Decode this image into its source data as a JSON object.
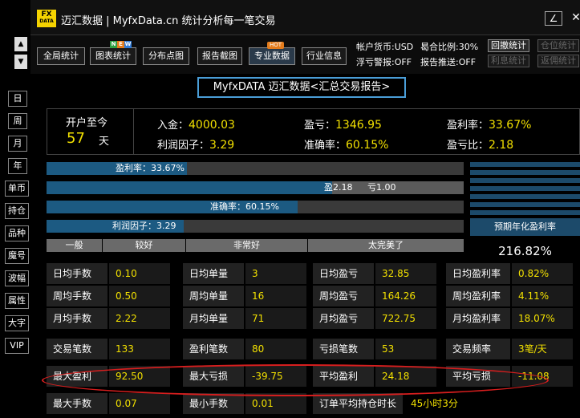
{
  "app": {
    "logo_top": "FX",
    "logo_bottom": "DATA",
    "title": "迈汇数据 | MyfxData.cn   统计分析每一笔交易"
  },
  "window_controls": {
    "minimize": "∠",
    "close": "✕"
  },
  "sidebar": {
    "scroll_up": "▲",
    "scroll_down": "▼",
    "timeframes": [
      "日",
      "周",
      "月",
      "年"
    ],
    "tools": [
      "单币",
      "持仓",
      "品种",
      "魔号",
      "波幅",
      "属性",
      "大字",
      "VIP"
    ]
  },
  "toolbar": {
    "buttons": [
      "全局统计",
      "图表统计",
      "分布点图",
      "报告截图",
      "专业数据",
      "行业信息"
    ],
    "new_badge": [
      "N",
      "E",
      "W"
    ],
    "hot_badge": "HOT",
    "account_currency": "帐户货币:USD",
    "leverage": "曷合比例:30%",
    "float_alert": "浮亏警报:OFF",
    "report_push": "报告推送:OFF",
    "btn_withdraw_stats": "回撤统计",
    "btn_position_stats": "仓位统计",
    "btn_interest_stats": "利息统计",
    "btn_rebate_stats": "返佣统计"
  },
  "report": {
    "title": "MyfxDATA 迈汇数据<汇总交易报告>",
    "open_since_label": "开户至今",
    "open_days": "57",
    "open_days_unit": "天",
    "deposit_label": "入金：",
    "deposit_value": "4000.03",
    "profit_label": "盈亏：",
    "profit_value": "1346.95",
    "profit_rate_label": "盈利率：",
    "profit_rate_value": "33.67%",
    "profit_factor_label": "利润因子：",
    "profit_factor_value": "3.29",
    "accuracy_label": "准确率：",
    "accuracy_value": "60.15%",
    "pl_ratio_label": "盈亏比：",
    "pl_ratio_value": "2.18"
  },
  "bars": {
    "profit_rate": {
      "label": "盈利率：33.67%",
      "fraction": 0.3367
    },
    "pl_ratio": {
      "win_label": "盈2.18",
      "loss_label": "亏1.00",
      "win_fraction": 0.6855
    },
    "accuracy": {
      "label": "准确率：60.15%",
      "fraction": 0.6015
    },
    "profit_factor": {
      "label": "利润因子：3.29",
      "fraction": 0.329
    }
  },
  "grades": [
    "一般",
    "较好",
    "非常好",
    "太完美了"
  ],
  "annual": {
    "label": "预期年化盈利率",
    "value": "216.82%"
  },
  "stats": [
    [
      [
        "日均手数",
        "0.10"
      ],
      [
        "日均单量",
        "3"
      ],
      [
        "日均盈亏",
        "32.85"
      ],
      [
        "日均盈利率",
        "0.82%"
      ]
    ],
    [
      [
        "周均手数",
        "0.50"
      ],
      [
        "周均单量",
        "16"
      ],
      [
        "周均盈亏",
        "164.26"
      ],
      [
        "周均盈利率",
        "4.11%"
      ]
    ],
    [
      [
        "月均手数",
        "2.22"
      ],
      [
        "月均单量",
        "71"
      ],
      [
        "月均盈亏",
        "722.75"
      ],
      [
        "月均盈利率",
        "18.07%"
      ]
    ],
    [
      [
        "交易笔数",
        "133"
      ],
      [
        "盈利笔数",
        "80"
      ],
      [
        "亏损笔数",
        "53"
      ],
      [
        "交易频率",
        "3笔/天"
      ]
    ],
    [
      [
        "最大盈利",
        "92.50"
      ],
      [
        "最大亏损",
        "-39.75"
      ],
      [
        "平均盈利",
        "24.18"
      ],
      [
        "平均亏损",
        "-11.08"
      ]
    ],
    [
      [
        "最大手数",
        "0.07"
      ],
      [
        "最小手数",
        "0.01"
      ],
      [
        "订单平均持仓时长",
        "45小时3分"
      ]
    ]
  ],
  "colors": {
    "accent_blue": "#1c5a82",
    "value_yellow": "#f2e000",
    "highlight_red": "#d81e1e"
  }
}
